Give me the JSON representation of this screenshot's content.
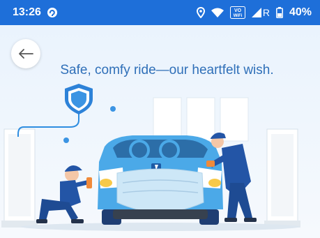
{
  "status_bar": {
    "time": "13:26",
    "vowifi_top": "VO",
    "vowifi_bottom": "WiFi",
    "network_letter": "R",
    "battery": "40%"
  },
  "hero": {
    "headline": "Safe, comfy ride—our heartfelt wish."
  },
  "icons": [
    "sync-icon",
    "location-icon",
    "wifi-icon",
    "signal-icon",
    "battery-icon",
    "back-arrow-icon",
    "shield-icon"
  ],
  "colors": {
    "status_bar": "#1e6fd9",
    "headline": "#2f6fb8",
    "car": "#49a8e6"
  }
}
